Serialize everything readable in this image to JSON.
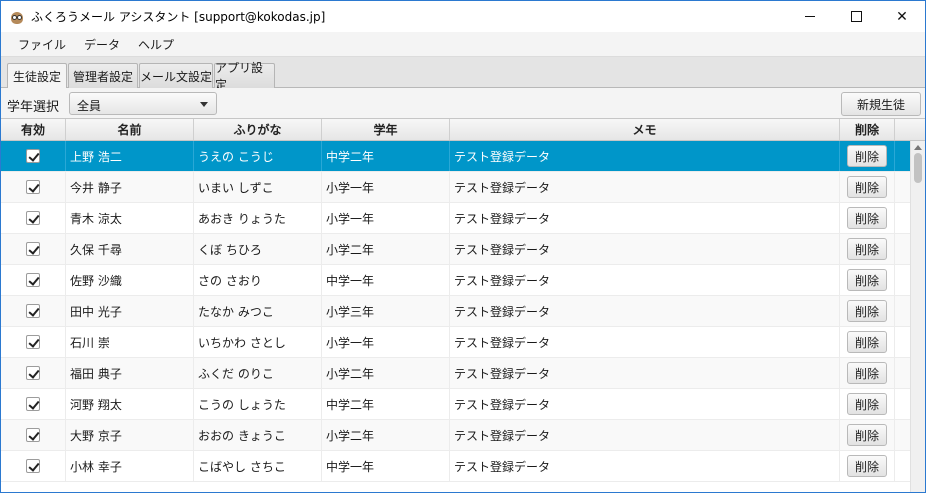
{
  "window": {
    "title": "ふくろうメール アシスタント [support@kokodas.jp]"
  },
  "menu": [
    "ファイル",
    "データ",
    "ヘルプ"
  ],
  "tabs": [
    "生徒設定",
    "管理者設定",
    "メール文設定",
    "アプリ設定"
  ],
  "toolbar": {
    "grade_label": "学年選択",
    "grade_value": "全員",
    "new_student_label": "新規生徒"
  },
  "table": {
    "headers": [
      "有効",
      "名前",
      "ふりがな",
      "学年",
      "メモ",
      "削除"
    ],
    "delete_label": "削除",
    "rows": [
      {
        "name": "上野 浩二",
        "furigana": "うえの こうじ",
        "grade": "中学二年",
        "memo": "テスト登録データ"
      },
      {
        "name": "今井 静子",
        "furigana": "いまい しずこ",
        "grade": "小学一年",
        "memo": "テスト登録データ"
      },
      {
        "name": "青木 涼太",
        "furigana": "あおき りょうた",
        "grade": "小学一年",
        "memo": "テスト登録データ"
      },
      {
        "name": "久保 千尋",
        "furigana": "くぼ ちひろ",
        "grade": "小学二年",
        "memo": "テスト登録データ"
      },
      {
        "name": "佐野 沙織",
        "furigana": "さの さおり",
        "grade": "中学一年",
        "memo": "テスト登録データ"
      },
      {
        "name": "田中 光子",
        "furigana": "たなか みつこ",
        "grade": "小学三年",
        "memo": "テスト登録データ"
      },
      {
        "name": "石川 崇",
        "furigana": "いちかわ さとし",
        "grade": "小学一年",
        "memo": "テスト登録データ"
      },
      {
        "name": "福田 典子",
        "furigana": "ふくだ のりこ",
        "grade": "小学二年",
        "memo": "テスト登録データ"
      },
      {
        "name": "河野 翔太",
        "furigana": "こうの しょうた",
        "grade": "中学二年",
        "memo": "テスト登録データ"
      },
      {
        "name": "大野 京子",
        "furigana": "おおの きょうこ",
        "grade": "小学二年",
        "memo": "テスト登録データ"
      },
      {
        "name": "小林 幸子",
        "furigana": "こばやし さちこ",
        "grade": "中学一年",
        "memo": "テスト登録データ"
      }
    ]
  }
}
